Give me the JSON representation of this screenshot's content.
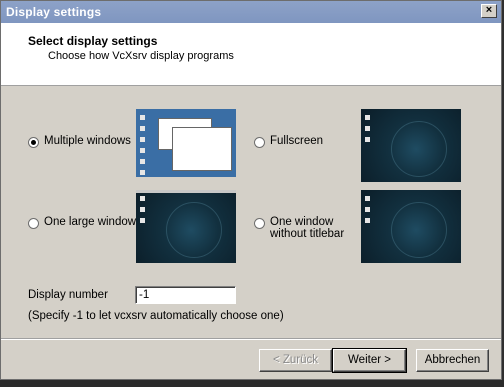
{
  "window": {
    "title": "Display settings",
    "close_glyph": "×"
  },
  "header": {
    "title": "Select display settings",
    "subtitle": "Choose how VcXsrv display programs"
  },
  "options": {
    "multiple": {
      "label": "Multiple windows",
      "checked": true
    },
    "fullscreen": {
      "label": "Fullscreen",
      "checked": false
    },
    "one_large": {
      "label": "One large window",
      "checked": false
    },
    "no_titlebar": {
      "label_line1": "One window",
      "label_line2": "without titlebar",
      "checked": false
    }
  },
  "display_number": {
    "label": "Display number",
    "value": "-1",
    "hint": "(Specify -1 to let vcxsrv automatically choose one)"
  },
  "buttons": {
    "back": "< Zurück",
    "next": "Weiter >",
    "cancel": "Abbrechen"
  },
  "colors": {
    "titlebar": "#8da2c8",
    "desktop_dark": "#12303f",
    "desktop_win": "#3a6ea5"
  }
}
